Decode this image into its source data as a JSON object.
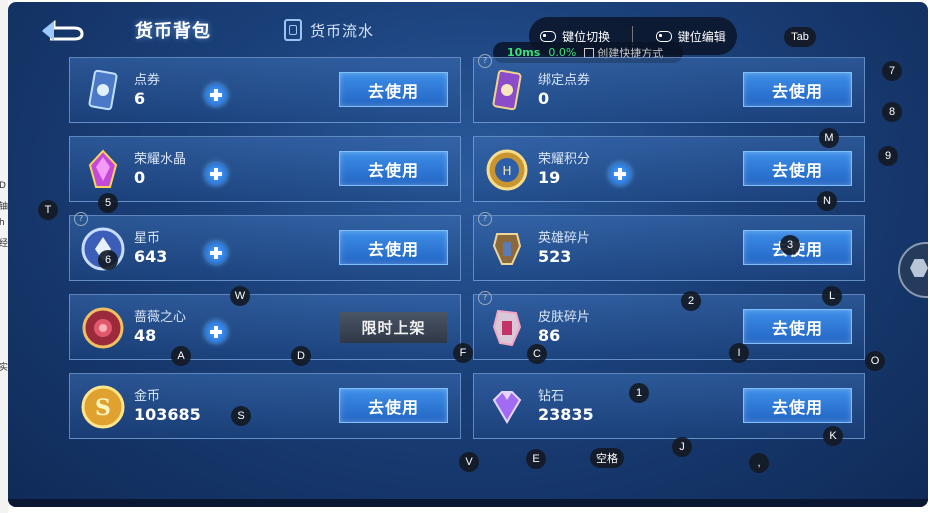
{
  "gutter_chars": [
    "D",
    "铀",
    "h",
    "经",
    "实"
  ],
  "header": {
    "title": "货币背包",
    "tab2": "货币流水"
  },
  "toolbar": {
    "key_switch": "键位切换",
    "key_edit": "键位编辑",
    "latency": "10ms",
    "loss": "0.0%",
    "shortcut": "创建快捷方式"
  },
  "cards": [
    {
      "name": "点券",
      "value": "6",
      "button": "去使用",
      "plus": true,
      "q": false
    },
    {
      "name": "绑定点券",
      "value": "0",
      "button": "去使用",
      "plus": false,
      "q": true
    },
    {
      "name": "荣耀水晶",
      "value": "0",
      "button": "去使用",
      "plus": true,
      "q": false
    },
    {
      "name": "荣耀积分",
      "value": "19",
      "button": "去使用",
      "plus": true,
      "q": false
    },
    {
      "name": "星币",
      "value": "643",
      "button": "去使用",
      "plus": true,
      "q": true
    },
    {
      "name": "英雄碎片",
      "value": "523",
      "button": "去使用",
      "plus": false,
      "q": true
    },
    {
      "name": "蔷薇之心",
      "value": "48",
      "button": "限时上架",
      "plus": true,
      "q": false
    },
    {
      "name": "皮肤碎片",
      "value": "86",
      "button": "去使用",
      "plus": false,
      "q": true
    },
    {
      "name": "金币",
      "value": "103685",
      "button": "去使用",
      "plus": false,
      "q": false
    },
    {
      "name": "钻石",
      "value": "23835",
      "button": "去使用",
      "plus": false,
      "q": false
    }
  ],
  "keys": [
    "Tab",
    "7",
    "8",
    "M",
    "9",
    "T",
    "5",
    "N",
    "6",
    "3",
    "W",
    "2",
    "L",
    "A",
    "D",
    "F",
    "C",
    "I",
    "O",
    "S",
    "1",
    "K",
    "J",
    "V",
    "E",
    "空格",
    ","
  ]
}
